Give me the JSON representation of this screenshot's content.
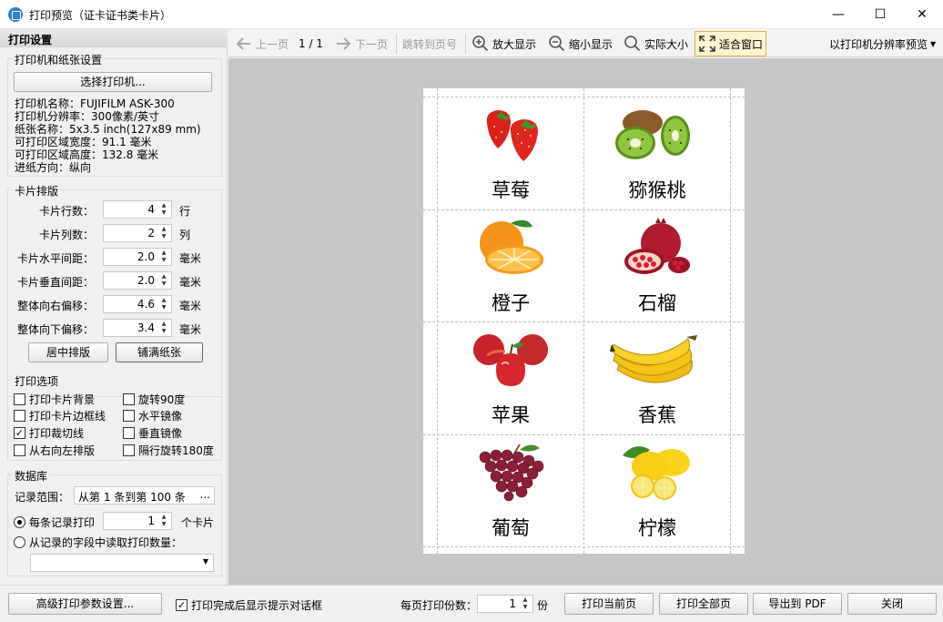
{
  "window": {
    "title": "打印预览（证卡证书类卡片）",
    "min_glyph": "—",
    "max_glyph": "☐",
    "close_glyph": "✕"
  },
  "panel": {
    "header": "打印设置",
    "printer_group": {
      "title": "打印机和纸张设置",
      "select_button": "选择打印机...",
      "info": [
        "打印机名称：FUJIFILM ASK-300",
        "打印机分辨率：300像素/英寸",
        "纸张名称：5x3.5 inch(127x89 mm)",
        "可打印区域宽度：91.1 毫米",
        "可打印区域高度：132.8 毫米",
        "进纸方向：纵向"
      ]
    },
    "layout_group": {
      "title": "卡片排版",
      "rows_label": "卡片行数：",
      "rows_value": "4",
      "rows_unit": "行",
      "cols_label": "卡片列数：",
      "cols_value": "2",
      "cols_unit": "列",
      "hgap_label": "卡片水平间距：",
      "hgap_value": "2.0",
      "hgap_unit": "毫米",
      "vgap_label": "卡片垂直间距：",
      "vgap_value": "2.0",
      "vgap_unit": "毫米",
      "right_label": "整体向右偏移：",
      "right_value": "4.6",
      "right_unit": "毫米",
      "down_label": "整体向下偏移：",
      "down_value": "3.4",
      "down_unit": "毫米",
      "center_button": "居中排版",
      "fill_button": "铺满纸张"
    },
    "options_group": {
      "title": "打印选项",
      "print_bg": "打印卡片背景",
      "rotate90": "旋转90度",
      "print_border": "打印卡片边框线",
      "hmirror": "水平镜像",
      "print_cut": "打印裁切线",
      "vmirror": "垂直镜像",
      "rtl": "从右向左排版",
      "alt_rotate": "隔行旋转180度",
      "check_mark": "✓"
    },
    "db_group": {
      "title": "数据库",
      "range_label": "记录范围：",
      "range_value": "从第 1 条到第 100 条",
      "range_more": "...",
      "per_record_label": "每条记录打印",
      "per_record_value": "1",
      "per_record_unit": "个卡片",
      "from_field_label": "从记录的字段中读取打印数量："
    }
  },
  "toolbar": {
    "prev": "上一页",
    "page_indicator": "1 / 1",
    "next": "下一页",
    "goto": "跳转到页号",
    "zoom_in": "放大显示",
    "zoom_out": "缩小显示",
    "actual": "实际大小",
    "fit": "适合窗口",
    "resolution": "以打印机分辨率预览"
  },
  "cards": [
    {
      "name": "草莓",
      "icon": "strawberry-icon"
    },
    {
      "name": "猕猴桃",
      "icon": "kiwi-icon"
    },
    {
      "name": "橙子",
      "icon": "orange-icon"
    },
    {
      "name": "石榴",
      "icon": "pomegranate-icon"
    },
    {
      "name": "苹果",
      "icon": "apple-icon"
    },
    {
      "name": "香蕉",
      "icon": "banana-icon"
    },
    {
      "name": "葡萄",
      "icon": "grape-icon"
    },
    {
      "name": "柠檬",
      "icon": "lemon-icon"
    }
  ],
  "bottom": {
    "advanced_button": "高级打印参数设置...",
    "show_dialog_label": "打印完成后显示提示对话框",
    "copies_label": "每页打印份数：",
    "copies_value": "1",
    "copies_unit": "份",
    "print_current": "打印当前页",
    "print_all": "打印全部页",
    "export_pdf": "导出到 PDF",
    "close": "关闭"
  }
}
